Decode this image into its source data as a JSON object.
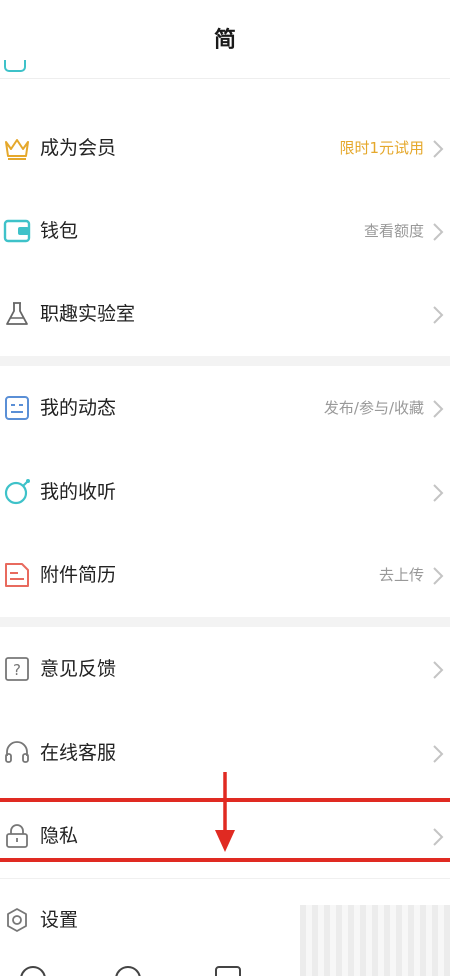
{
  "header": {
    "title": "简"
  },
  "menu": {
    "member": {
      "label": "成为会员",
      "aux": "限时1元试用"
    },
    "wallet": {
      "label": "钱包",
      "aux": "查看额度"
    },
    "lab": {
      "label": "职趣实验室",
      "aux": ""
    },
    "dynamics": {
      "label": "我的动态",
      "aux": "发布/参与/收藏"
    },
    "listening": {
      "label": "我的收听",
      "aux": ""
    },
    "resume": {
      "label": "附件简历",
      "aux": "去上传"
    },
    "feedback": {
      "label": "意见反馈",
      "aux": ""
    },
    "service": {
      "label": "在线客服",
      "aux": ""
    },
    "privacy": {
      "label": "隐私",
      "aux": ""
    },
    "settings": {
      "label": "设置",
      "aux": ""
    }
  },
  "colors": {
    "accent_gold": "#e5a82c",
    "icon_teal": "#3ec2c9",
    "icon_blue": "#5a8fd6",
    "icon_red": "#e86a5e",
    "highlight_red": "#e02a22"
  },
  "icons": {
    "member": "crown-icon",
    "wallet": "wallet-icon",
    "lab": "flask-icon",
    "dynamics": "list-icon",
    "listening": "headphone-circle-icon",
    "resume": "document-icon",
    "feedback": "question-icon",
    "service": "headset-icon",
    "privacy": "lock-icon",
    "settings": "gear-icon"
  }
}
